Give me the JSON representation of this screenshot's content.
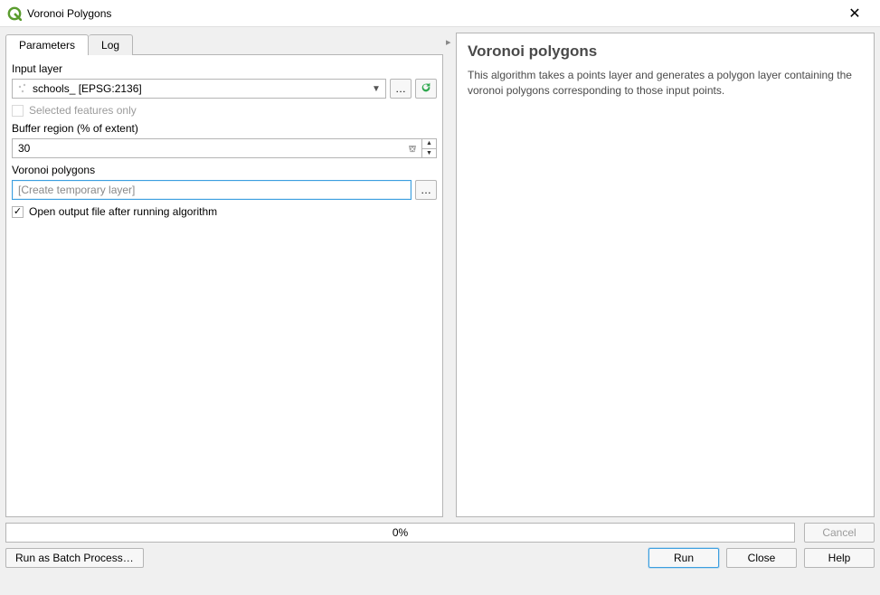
{
  "window": {
    "title": "Voronoi Polygons"
  },
  "tabs": {
    "parameters": "Parameters",
    "log": "Log"
  },
  "form": {
    "input_layer_label": "Input layer",
    "input_layer_value": "schools_ [EPSG:2136]",
    "browse_ellipsis": "…",
    "selected_only_label": "Selected features only",
    "buffer_label": "Buffer region (% of extent)",
    "buffer_value": "30",
    "voronoi_label": "Voronoi polygons",
    "voronoi_placeholder": "[Create temporary layer]",
    "open_output_label": "Open output file after running algorithm"
  },
  "help": {
    "title": "Voronoi polygons",
    "desc": "This algorithm takes a points layer and generates a polygon layer containing the voronoi polygons corresponding to those input points."
  },
  "footer": {
    "progress_text": "0%",
    "cancel": "Cancel",
    "batch": "Run as Batch Process…",
    "run": "Run",
    "close": "Close",
    "help": "Help"
  },
  "icons": {
    "app_color": "#5a9c2e",
    "reload_color": "#2fa84f"
  }
}
